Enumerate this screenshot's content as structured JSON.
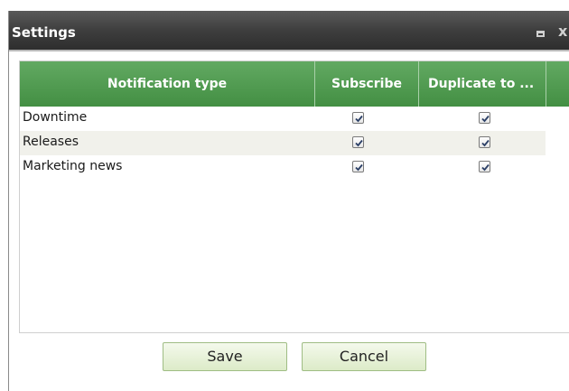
{
  "window": {
    "title": "Settings",
    "maximize_icon": "maximize-icon",
    "close_icon": "close-icon",
    "close_glyph": "x"
  },
  "grid": {
    "columns": [
      {
        "label": "Notification type"
      },
      {
        "label": "Subscribe"
      },
      {
        "label": "Duplicate to ..."
      },
      {
        "label": ""
      }
    ],
    "rows": [
      {
        "label": "Downtime",
        "subscribe": true,
        "duplicate": true
      },
      {
        "label": "Releases",
        "subscribe": true,
        "duplicate": true
      },
      {
        "label": "Marketing news",
        "subscribe": true,
        "duplicate": true
      }
    ]
  },
  "buttons": {
    "save_label": "Save",
    "cancel_label": "Cancel"
  },
  "colors": {
    "header_green": "#4f9a4f",
    "titlebar_dark": "#3e3e3e",
    "button_green_light": "#e8f2dc",
    "alt_row": "#f1f1eb"
  }
}
